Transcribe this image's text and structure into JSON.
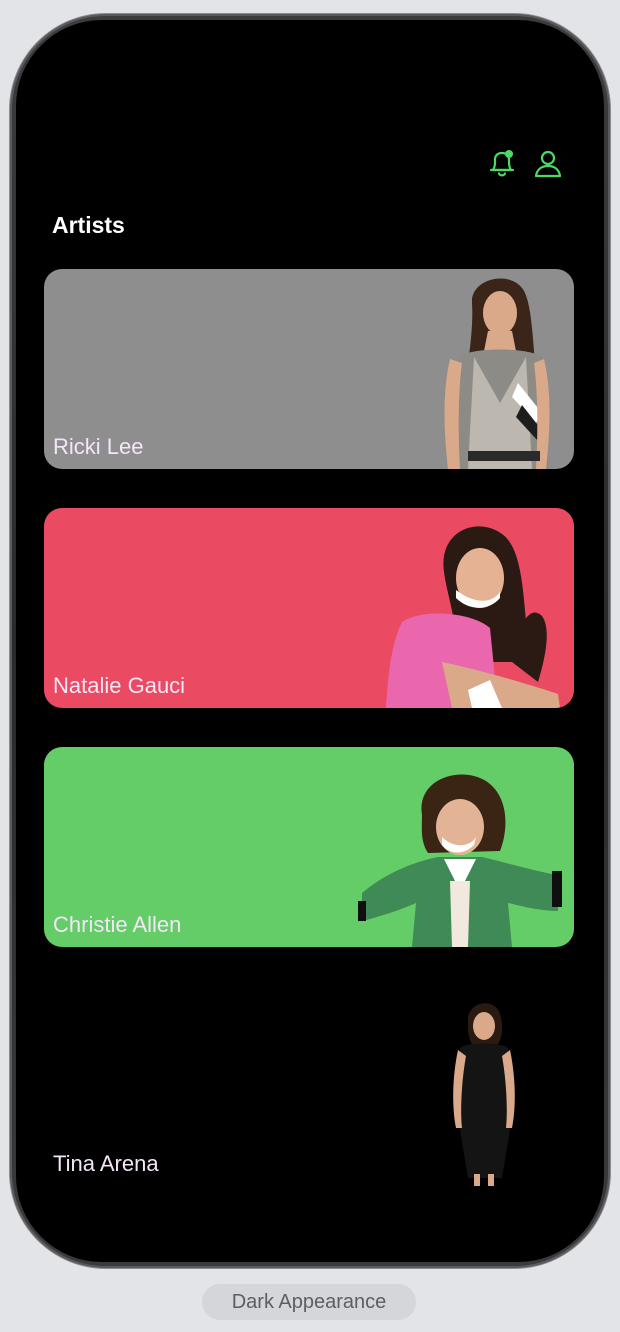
{
  "header": {
    "notification_icon": "bell-with-badge-icon",
    "profile_icon": "person-icon",
    "accent": "#4cd964"
  },
  "section": {
    "title": "Artists"
  },
  "artists": [
    {
      "name": "Ricki Lee",
      "color": "#8e8e8e"
    },
    {
      "name": "Natalie Gauci",
      "color": "#ea4b63"
    },
    {
      "name": "Christie Allen",
      "color": "#65cd68"
    },
    {
      "name": "Tina Arena",
      "color": "#000000"
    }
  ],
  "footer": {
    "caption": "Dark Appearance"
  }
}
